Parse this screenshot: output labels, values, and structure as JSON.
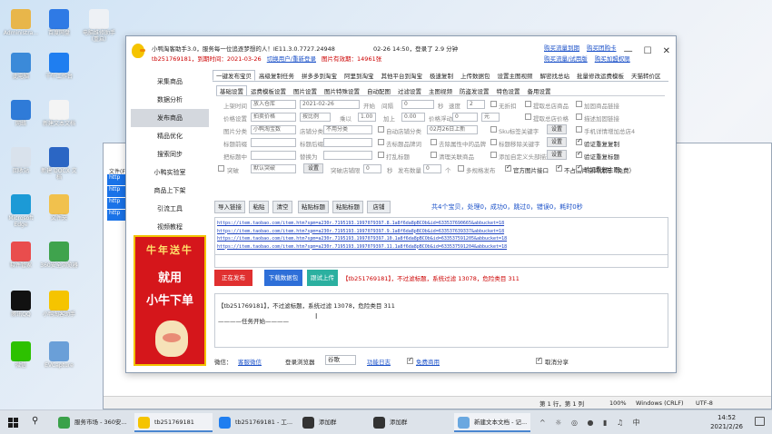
{
  "desktop": {
    "icons": [
      {
        "label": "Administra...",
        "icon": "user-folder-icon",
        "color": "#e8b64a"
      },
      {
        "label": "百度网盘",
        "icon": "baidu-netdisk-icon",
        "color": "#2f7ae5"
      },
      {
        "label": "电脑维修助手（重启）",
        "icon": "repair-tool-icon",
        "color": "#eef1f5"
      },
      {
        "label": "此电脑",
        "icon": "computer-icon",
        "color": "#3b8ad9"
      },
      {
        "label": "千牛工作台",
        "icon": "qianniu-icon",
        "color": "#1f7ef0"
      },
      {
        "label": "网络",
        "icon": "network-icon",
        "color": "#2f7bd8"
      },
      {
        "label": "新建文本文档",
        "icon": "text-file-icon",
        "color": "#f4f4f4"
      },
      {
        "label": "回收站",
        "icon": "recycle-bin-icon",
        "color": "#d9e2ec"
      },
      {
        "label": "新建 DOCX 文档",
        "icon": "docx-icon",
        "color": "#2b66c4"
      },
      {
        "label": "Microsoft Edge",
        "icon": "edge-icon",
        "color": "#1c9ad6"
      },
      {
        "label": "文件夹",
        "icon": "folder-icon",
        "color": "#f1c14d"
      },
      {
        "label": "软件管家",
        "icon": "software-manager-icon",
        "color": "#e94d4d"
      },
      {
        "label": "360安全浏览器",
        "icon": "ie-icon",
        "color": "#3fa34d"
      },
      {
        "label": "腾讯QQ",
        "icon": "qq-icon",
        "color": "#111111"
      },
      {
        "label": "小鸭淘客助手",
        "icon": "duck-icon",
        "color": "#f5c400"
      },
      {
        "label": "微信",
        "icon": "wechat-icon",
        "color": "#2dc100"
      },
      {
        "label": "EVCapture",
        "icon": "evcapture-icon",
        "color": "#6a9fd8"
      }
    ]
  },
  "notepad": {
    "menu": "文件(F)",
    "status": {
      "pos": "第 1 行，第 1 列",
      "zoom": "100%",
      "eol": "Windows (CRLF)",
      "enc": "UTF-8"
    },
    "side_links": [
      "http",
      "http",
      "http",
      "http"
    ]
  },
  "app": {
    "title": "小鸭淘客助手3.0，服务每一位追逐梦想的人！IE11.3.0.7727.24948",
    "date_login": "02-26 14:50，登录了 2.9 分钟",
    "account_line": "tb251769181，到期时间：2021-03-26",
    "switch_link": "切换用户/重新登录",
    "image_count": "图片有效期：14961张",
    "top_links": [
      "购买流量到期",
      "购买团购卡",
      "购买流量/试用版",
      "购买加盟权限"
    ],
    "nav": [
      "采集商品",
      "数据分析",
      "发布商品",
      "精品优化",
      "搜索同步",
      "小鸭实验室",
      "商品上下架",
      "引流工具",
      "视频教程"
    ],
    "nav_active": 2,
    "ad": {
      "line1": "牛年送牛",
      "line2": "就用",
      "line3": "小牛下单"
    },
    "tabs1": [
      "一键发布宝贝",
      "高级复制任务",
      "拼多多到淘宝",
      "阿里到淘宝",
      "其他平台到淘宝",
      "极速复制",
      "上传数据包",
      "设置主图视频",
      "解密找总站",
      "批量修改运费模板",
      "天猫转价区"
    ],
    "tabs2": [
      "基础设置",
      "运费模板设置",
      "图片设置",
      "图片特殊设置",
      "自动配图",
      "过滤设置",
      "主图视频",
      "防盗发设置",
      "特色设置",
      "备用设置"
    ],
    "form": {
      "send_time_label": "上架时间",
      "send_time_value": "放入仓库",
      "time_value": "2021-02-26 15:07:50",
      "open_label": "开始",
      "interval_label": "间隔",
      "interval_value": "0",
      "sec_label": "秒",
      "speed_label": "速度",
      "speed_value": "2",
      "no_discount": "无折扣",
      "fetch_original": "提取总店商品",
      "add_related": "加固商品链接",
      "price_label": "价格设置",
      "price_mode": "拍卖价格",
      "price_op": "按比例",
      "mult_label": "乘以",
      "mult_value": "1.00",
      "add_label": "加上",
      "add_value": "0.00",
      "price_adjust": "价格浮动",
      "adjust_value": "0",
      "yuan": "元",
      "fetch_total": "提取总店价格",
      "link_filter": "描述加固链接",
      "phone_desc": "手机详情增加总店4",
      "img_label": "图片分类",
      "img_value": "小鸭淘宝数",
      "shop_label": "店铺分类",
      "shop_value": "不用分类",
      "auto_cat": "自动店铺分类",
      "cat_date": "02月26日上新",
      "sku_kw": "Sku标签关键字",
      "set_btn": "设置",
      "title_filter": "验证重复复制",
      "title_pre_label": "标题前缀",
      "title_suf_label": "标题后缀",
      "remove_brand": "去标题品牌词",
      "remove_chinese": "去除属性中的品牌",
      "title_kw": "标题移除关键字",
      "repeat_title": "验证重复标题",
      "replace_title_label": "把标题中",
      "replace_with_label": "替换为",
      "mark_tag": "打乱标题",
      "clean_link": "清理关联商品",
      "add_custom": "添加自定义头部描述",
      "repeat_main": "验证重复主图",
      "highlight_label": "突破",
      "highlight_value": "默认突破",
      "shop_limit": "突破店铺限",
      "limit_value": "0",
      "publish_count_label": "发布数量",
      "publish_count_value": "0",
      "unit": "个",
      "multi_spec": "多规格发布",
      "official_img": "官方图片接口",
      "no_space": "不占图片空间优先（免费）"
    },
    "actions": [
      "导入链接",
      "粘贴",
      "清空",
      "粘贴标题",
      "粘贴标题",
      "店铺"
    ],
    "stats": "共4个宝贝，处理0，成功0，跳过0，错误0，耗时0秒",
    "urls": [
      "https://item.taobao.com/item.htm?spm=a230r.7195193.1997079397.8.1a8f6da8pBCOb&id=633537690665&abbucket=18",
      "https://item.taobao.com/item.htm?spm=a230r.7195193.1997079397.9.1a8f6da8pBCOb&id=633537639337&abbucket=18",
      "https://item.taobao.com/item.htm?spm=a230r.7195193.1997079397.10.1a8f6da8pBCOb&id=633537591205&abbucket=18",
      "https://item.taobao.com/item.htm?spm=a230r.7195193.1997079397.11.1a8f6da8pBCOb&id=633537591204&abbucket=18"
    ],
    "bottom_buttons": {
      "publishing": "正在发布",
      "download": "下载数据包",
      "tm_upload": "跟试上传"
    },
    "bottom_msg": "【tb251769181】，不过滤标题，系统过滤 13078，危险类目 311",
    "log": {
      "line1": "【tb251769181】，不过滤标题，系统过滤 13078，危险类目 311",
      "line2": "————任务开始————"
    },
    "footer": {
      "wechat_label": "微信：",
      "wechat_link": "客服微信",
      "browser_label": "登录浏览器",
      "browser_value": "谷歌",
      "cloud_link": "功能日志",
      "free_link": "免费商用",
      "share": "取消分享"
    }
  },
  "taskbar": {
    "items": [
      {
        "label": "服务市场 - 360安...",
        "icon": "browser-360-icon",
        "color": "#3aa14a"
      },
      {
        "label": "tb251769181",
        "icon": "duck-icon",
        "color": "#f5c400"
      },
      {
        "label": "tb251769181 - 工...",
        "icon": "qianniu-icon",
        "color": "#1f7ef0"
      },
      {
        "label": "添加群",
        "icon": "qq-icon",
        "color": "#333333"
      },
      {
        "label": "添加群",
        "icon": "qq-icon",
        "color": "#333333"
      },
      {
        "label": "新建文本文档 - 记...",
        "icon": "notepad-icon",
        "color": "#6aa8e0"
      }
    ],
    "time": "14:52",
    "date": "2021/2/26"
  }
}
